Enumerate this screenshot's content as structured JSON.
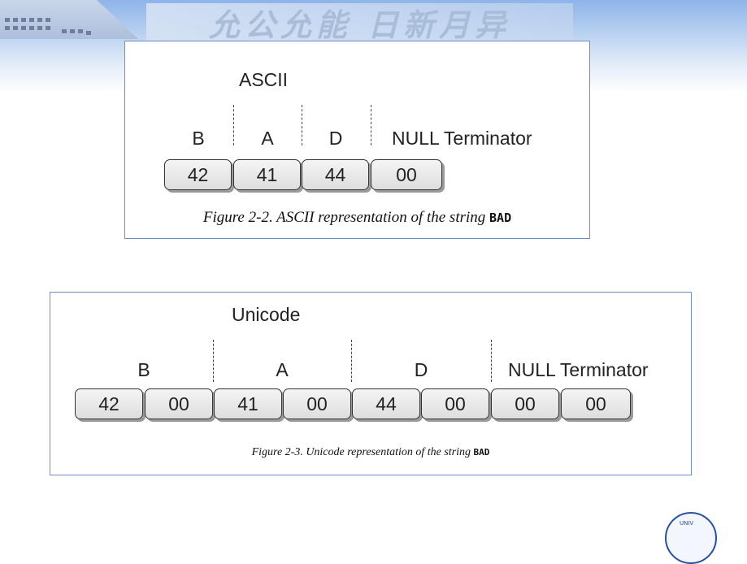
{
  "header": {
    "motto": "允公允能 日新月异"
  },
  "figure_ascii": {
    "encoding_label": "ASCII",
    "chars": [
      "B",
      "A",
      "D",
      "NULL Terminator"
    ],
    "bytes": [
      "42",
      "41",
      "44",
      "00"
    ],
    "caption_prefix": "Figure 2-2. ASCII representation of the string",
    "caption_code": "BAD"
  },
  "figure_unicode": {
    "encoding_label": "Unicode",
    "chars": [
      "B",
      "A",
      "D",
      "NULL Terminator"
    ],
    "bytes": [
      "42",
      "00",
      "41",
      "00",
      "44",
      "00",
      "00",
      "00"
    ],
    "caption_prefix": "Figure 2-3. Unicode representation of the string",
    "caption_code": "BAD"
  },
  "footer": {
    "seal_text": "UNIV"
  }
}
